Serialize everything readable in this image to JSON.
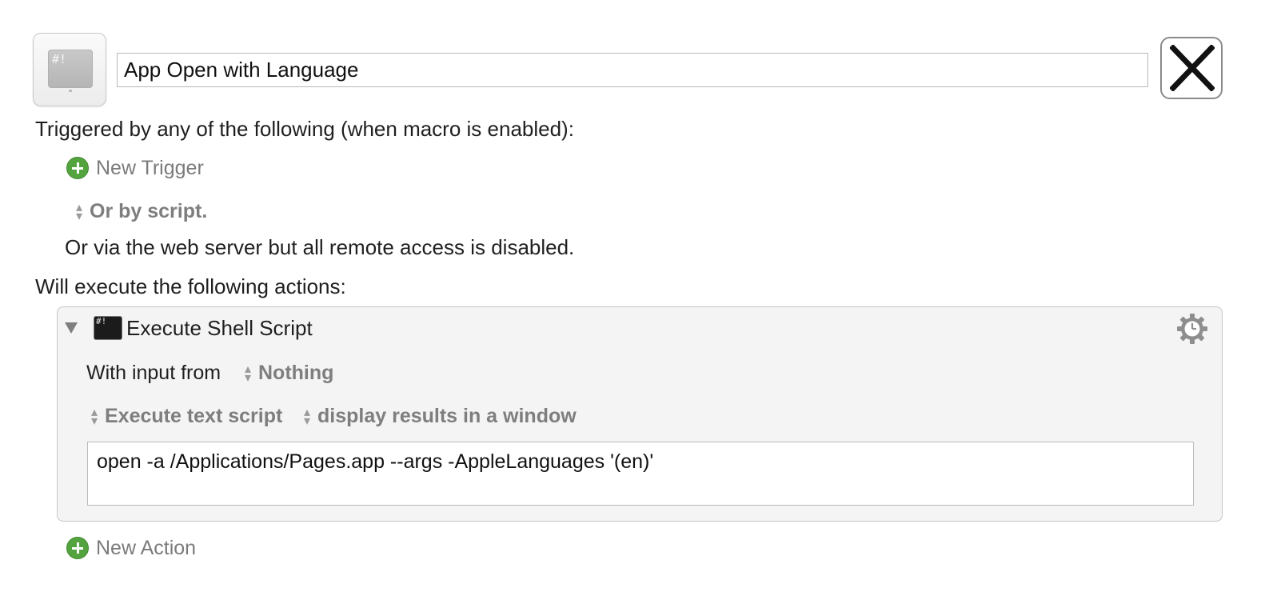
{
  "macro": {
    "name": "App Open with Language",
    "icon_label": "#!"
  },
  "triggers": {
    "heading": "Triggered by any of the following (when macro is enabled):",
    "new_trigger_label": "New Trigger",
    "or_by_script": "Or by script.",
    "web_server_note": "Or via the web server but all remote access is disabled."
  },
  "actions": {
    "heading": "Will execute the following actions:",
    "items": [
      {
        "icon": "terminal-icon",
        "icon_label": "#!",
        "title": "Execute Shell Script",
        "input_label": "With input from",
        "input_value": "Nothing",
        "source_value": "Execute text script",
        "output_value": "display results in a window",
        "script": "open -a /Applications/Pages.app --args -AppleLanguages '(en)'"
      }
    ],
    "new_action_label": "New Action"
  },
  "colors": {
    "add_green": "#53a33f",
    "muted_text": "#7b7b7b",
    "action_bg": "#f4f4f4"
  }
}
